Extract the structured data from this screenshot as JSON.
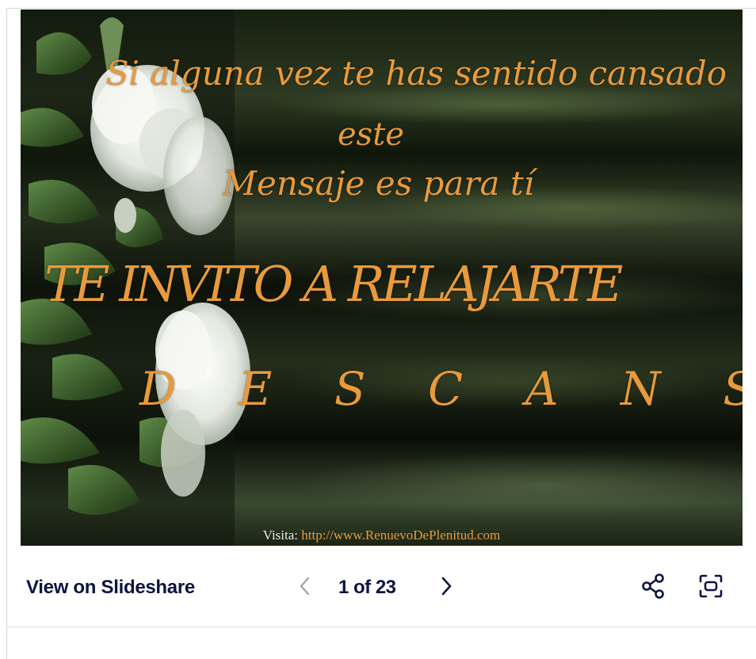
{
  "slide": {
    "lines": [
      "Si alguna vez te has sentido cansado",
      "este",
      "Mensaje es para tí",
      "TE INVITO A RELAJARTE",
      "D E S C A N S A"
    ],
    "visit_label": "Visita:",
    "visit_url": "http://www.RenuevoDePlenitud.com",
    "text_color": "#e89a3c"
  },
  "toolbar": {
    "view_label": "View on Slideshare",
    "counter": "1 of 23",
    "icons": {
      "prev": "chevron-left-icon",
      "next": "chevron-right-icon",
      "share": "share-icon",
      "fullscreen": "fullscreen-icon"
    },
    "text_color": "#0b1540"
  }
}
